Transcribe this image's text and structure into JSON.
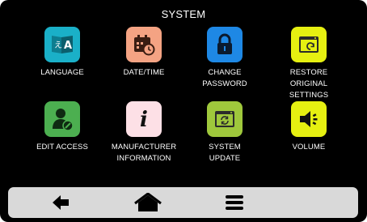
{
  "screen": {
    "title": "SYSTEM"
  },
  "tiles": [
    {
      "label": "LANGUAGE",
      "icon": "language-icon",
      "color": "#1ab0c8"
    },
    {
      "label": "DATE/TIME",
      "icon": "calendar-clock-icon",
      "color": "#f4a383"
    },
    {
      "label": "CHANGE\nPASSWORD",
      "icon": "padlock-icon",
      "color": "#1e88e5"
    },
    {
      "label": "RESTORE\nORIGINAL SETTINGS",
      "icon": "restore-window-icon",
      "color": "#e6f011"
    },
    {
      "label": "EDIT ACCESS",
      "icon": "user-edit-icon",
      "color": "#4caf50"
    },
    {
      "label": "MANUFACTURER\nINFORMATION",
      "icon": "info-icon",
      "color": "#fde0e6"
    },
    {
      "label": "SYSTEM\nUPDATE",
      "icon": "update-window-icon",
      "color": "#9fc83c"
    },
    {
      "label": "VOLUME",
      "icon": "speaker-icon",
      "color": "#e6f011"
    }
  ],
  "bottom_bar": {
    "items": [
      {
        "icon": "back-arrow-icon"
      },
      {
        "icon": "home-icon"
      },
      {
        "icon": "menu-icon"
      }
    ]
  }
}
